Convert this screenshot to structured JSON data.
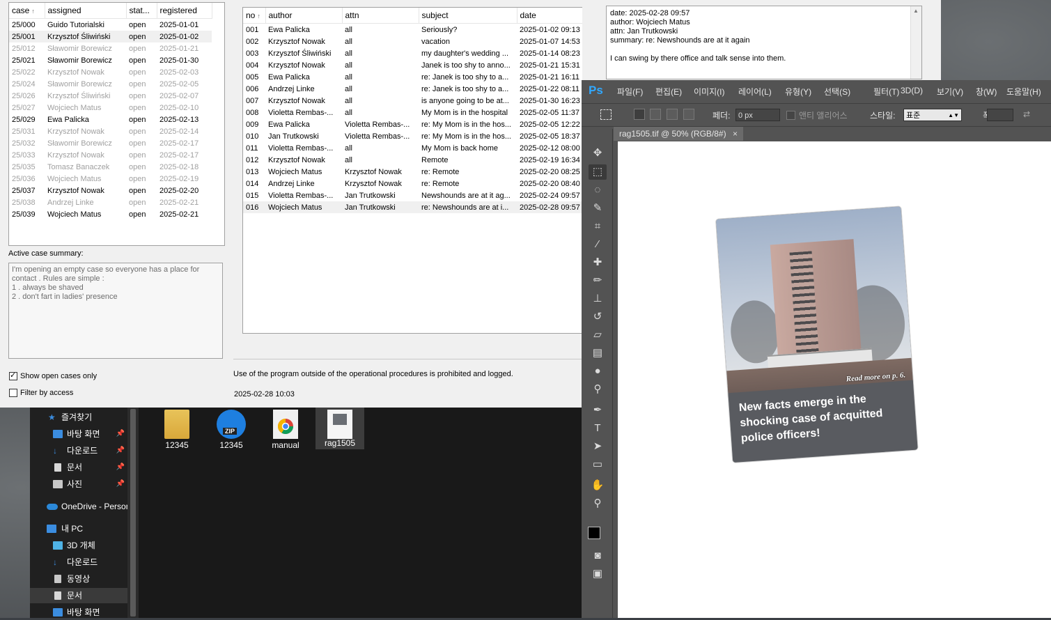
{
  "case_table": {
    "columns": [
      "case",
      "assigned",
      "stat...",
      "registered"
    ],
    "rows": [
      {
        "case": "25/000",
        "assigned": "Guido Tutorialski",
        "status": "open",
        "registered": "2025-01-01",
        "dim": false,
        "hl": false
      },
      {
        "case": "25/001",
        "assigned": "Krzysztof Śliwiński",
        "status": "open",
        "registered": "2025-01-02",
        "dim": false,
        "hl": true
      },
      {
        "case": "25/012",
        "assigned": "Sławomir Borewicz",
        "status": "open",
        "registered": "2025-01-21",
        "dim": true,
        "hl": false
      },
      {
        "case": "25/021",
        "assigned": "Sławomir Borewicz",
        "status": "open",
        "registered": "2025-01-30",
        "dim": false,
        "hl": false
      },
      {
        "case": "25/022",
        "assigned": "Krzysztof Nowak",
        "status": "open",
        "registered": "2025-02-03",
        "dim": true,
        "hl": false
      },
      {
        "case": "25/024",
        "assigned": "Sławomir Borewicz",
        "status": "open",
        "registered": "2025-02-05",
        "dim": true,
        "hl": false
      },
      {
        "case": "25/026",
        "assigned": "Krzysztof Śliwiński",
        "status": "open",
        "registered": "2025-02-07",
        "dim": true,
        "hl": false
      },
      {
        "case": "25/027",
        "assigned": "Wojciech Matus",
        "status": "open",
        "registered": "2025-02-10",
        "dim": true,
        "hl": false
      },
      {
        "case": "25/029",
        "assigned": "Ewa Palicka",
        "status": "open",
        "registered": "2025-02-13",
        "dim": false,
        "hl": false
      },
      {
        "case": "25/031",
        "assigned": "Krzysztof Nowak",
        "status": "open",
        "registered": "2025-02-14",
        "dim": true,
        "hl": false
      },
      {
        "case": "25/032",
        "assigned": "Sławomir Borewicz",
        "status": "open",
        "registered": "2025-02-17",
        "dim": true,
        "hl": false
      },
      {
        "case": "25/033",
        "assigned": "Krzysztof Nowak",
        "status": "open",
        "registered": "2025-02-17",
        "dim": true,
        "hl": false
      },
      {
        "case": "25/035",
        "assigned": "Tomasz Banaczek",
        "status": "open",
        "registered": "2025-02-18",
        "dim": true,
        "hl": false
      },
      {
        "case": "25/036",
        "assigned": "Wojciech Matus",
        "status": "open",
        "registered": "2025-02-19",
        "dim": true,
        "hl": false
      },
      {
        "case": "25/037",
        "assigned": "Krzysztof Nowak",
        "status": "open",
        "registered": "2025-02-20",
        "dim": false,
        "hl": false
      },
      {
        "case": "25/038",
        "assigned": "Andrzej Linke",
        "status": "open",
        "registered": "2025-02-21",
        "dim": true,
        "hl": false
      },
      {
        "case": "25/039",
        "assigned": "Wojciech Matus",
        "status": "open",
        "registered": "2025-02-21",
        "dim": false,
        "hl": false
      }
    ]
  },
  "summary": {
    "label": "Active case summary:",
    "text": "I'm opening an empty case so everyone has a place for\ncontact . Rules are simple :\n1 . always be shaved\n2 . don't fart in ladies' presence"
  },
  "filters": {
    "show_open": "Show open cases only",
    "filter_access": "Filter by access"
  },
  "msg_table": {
    "columns": [
      "no",
      "author",
      "attn",
      "subject",
      "date"
    ],
    "rows": [
      {
        "no": "001",
        "author": "Ewa Palicka",
        "attn": "all",
        "subject": "Seriously?",
        "date": "2025-01-02 09:13"
      },
      {
        "no": "002",
        "author": "Krzysztof Nowak",
        "attn": "all",
        "subject": "vacation",
        "date": "2025-01-07 14:53"
      },
      {
        "no": "003",
        "author": "Krzysztof Śliwiński",
        "attn": "all",
        "subject": "my daughter's wedding ...",
        "date": "2025-01-14 08:23"
      },
      {
        "no": "004",
        "author": "Krzysztof Nowak",
        "attn": "all",
        "subject": "Janek is too shy to anno...",
        "date": "2025-01-21 15:31"
      },
      {
        "no": "005",
        "author": "Ewa Palicka",
        "attn": "all",
        "subject": "re: Janek is too shy to a...",
        "date": "2025-01-21 16:11"
      },
      {
        "no": "006",
        "author": "Andrzej Linke",
        "attn": "all",
        "subject": "re: Janek is too shy to a...",
        "date": "2025-01-22 08:11"
      },
      {
        "no": "007",
        "author": "Krzysztof Nowak",
        "attn": "all",
        "subject": "is anyone going to be at...",
        "date": "2025-01-30 16:23"
      },
      {
        "no": "008",
        "author": "Violetta Rembas-...",
        "attn": "all",
        "subject": "My Mom is in the hospital",
        "date": "2025-02-05 11:37"
      },
      {
        "no": "009",
        "author": "Ewa Palicka",
        "attn": "Violetta Rembas-...",
        "subject": "re: My Mom is in the hos...",
        "date": "2025-02-05 12:22"
      },
      {
        "no": "010",
        "author": "Jan Trutkowski",
        "attn": "Violetta Rembas-...",
        "subject": "re: My Mom is in the hos...",
        "date": "2025-02-05 18:37"
      },
      {
        "no": "011",
        "author": "Violetta Rembas-...",
        "attn": "all",
        "subject": "My Mom is back home",
        "date": "2025-02-12 08:00"
      },
      {
        "no": "012",
        "author": "Krzysztof Nowak",
        "attn": "all",
        "subject": "Remote",
        "date": "2025-02-19 16:34"
      },
      {
        "no": "013",
        "author": "Wojciech Matus",
        "attn": "Krzysztof Nowak",
        "subject": "re: Remote",
        "date": "2025-02-20 08:25"
      },
      {
        "no": "014",
        "author": "Andrzej Linke",
        "attn": "Krzysztof Nowak",
        "subject": "re: Remote",
        "date": "2025-02-20 08:40"
      },
      {
        "no": "015",
        "author": "Violetta Rembas-...",
        "attn": "Jan Trutkowski",
        "subject": "Newshounds are at it ag...",
        "date": "2025-02-24 09:57"
      },
      {
        "no": "016",
        "author": "Wojciech Matus",
        "attn": "Jan Trutkowski",
        "subject": "re: Newshounds are at i...",
        "date": "2025-02-28 09:57"
      }
    ]
  },
  "detail": {
    "text": "date: 2025-02-28 09:57\nauthor: Wojciech Matus\nattn: Jan Trutkowski\nsummary: re: Newshounds are at it again\n\nI can swing by there office and talk sense into them."
  },
  "status": {
    "warning": "Use of the program outside of the operational procedures is prohibited and logged.",
    "datetime": "2025-02-28 10:03"
  },
  "explorer": {
    "nav": [
      {
        "label": "즐겨찾기",
        "pin": "",
        "color": "#3b8de0"
      },
      {
        "label": "바탕 화면",
        "pin": "📌",
        "color": "#3b8de0"
      },
      {
        "label": "다운로드",
        "pin": "📌",
        "color": "#3b8de0"
      },
      {
        "label": "문서",
        "pin": "📌",
        "color": "#c8c8c8"
      },
      {
        "label": "사진",
        "pin": "📌",
        "color": "#c8c8c8"
      },
      {
        "label": "OneDrive - Person",
        "pin": "",
        "color": "#2b88d8"
      },
      {
        "label": "내 PC",
        "pin": "",
        "color": "#3b8de0"
      },
      {
        "label": "3D 개체",
        "pin": "",
        "color": "#4fb3e6"
      },
      {
        "label": "다운로드",
        "pin": "",
        "color": "#3b8de0"
      },
      {
        "label": "동영상",
        "pin": "",
        "color": "#c8c8c8"
      },
      {
        "label": "문서",
        "pin": "",
        "color": "#c8c8c8"
      },
      {
        "label": "바탕 화면",
        "pin": "",
        "color": "#3b8de0"
      }
    ],
    "files": [
      {
        "label": "12345",
        "icon": "folder-icon"
      },
      {
        "label": "12345",
        "icon": "zip-icon",
        "badge": "ZIP"
      },
      {
        "label": "manual",
        "icon": "chrome-icon"
      },
      {
        "label": "rag1505",
        "icon": "tif-file-icon"
      }
    ]
  },
  "photoshop": {
    "logo": "Ps",
    "menu": [
      "파일(F)",
      "편집(E)",
      "이미지(I)",
      "레이어(L)",
      "유형(Y)",
      "선택(S)",
      "필터(T)",
      "3D(D)",
      "보기(V)",
      "창(W)",
      "도움말(H)"
    ],
    "options": {
      "feather_label": "페더:",
      "feather_value": "0 px",
      "antialias": "앤티 앨리어스",
      "style_label": "스타일:",
      "style_value": "표준",
      "width_label": "폭:"
    },
    "tab": "rag1505.tif @ 50% (RGB/8#)",
    "tab_close": "×",
    "photo": {
      "readmore": "Read more on p. 6.",
      "headline": "New facts emerge in the shocking case of acquitted police officers!"
    }
  }
}
